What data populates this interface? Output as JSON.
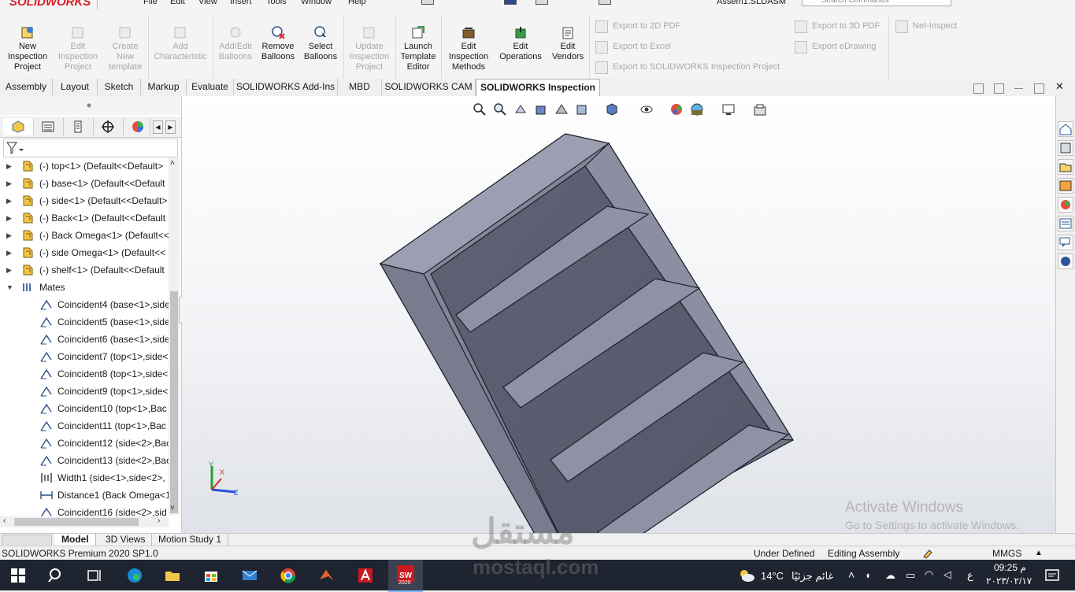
{
  "app": {
    "logo": "SOLIDWORKS",
    "filename": "Assem1.SLDASM",
    "search_placeholder": "Search Commands"
  },
  "menu": [
    "File",
    "Edit",
    "View",
    "Insert",
    "Tools",
    "Window",
    "Help"
  ],
  "ribbon": {
    "buttons": [
      {
        "label": "New\nInspection\nProject",
        "icon": "new-inspection-icon",
        "enabled": true
      },
      {
        "label": "Edit\nInspection\nProject",
        "icon": "edit-project-icon",
        "enabled": false
      },
      {
        "label": "Create\nNew\ntemplate",
        "icon": "create-template-icon",
        "enabled": false
      },
      {
        "label": "Add\nCharacteristic",
        "icon": "add-characteristic-icon",
        "enabled": false
      },
      {
        "label": "Add/Edit\nBalloons",
        "icon": "balloon-icon",
        "enabled": false
      },
      {
        "label": "Remove\nBalloons",
        "icon": "remove-balloon-icon",
        "enabled": true
      },
      {
        "label": "Select\nBalloons",
        "icon": "select-balloon-icon",
        "enabled": true
      },
      {
        "label": "Update\nInspection\nProject",
        "icon": "update-project-icon",
        "enabled": false
      },
      {
        "label": "Launch\nTemplate\nEditor",
        "icon": "template-editor-icon",
        "enabled": true
      },
      {
        "label": "Edit\nInspection\nMethods",
        "icon": "inspection-methods-icon",
        "enabled": true
      },
      {
        "label": "Edit\nOperations",
        "icon": "operations-icon",
        "enabled": true
      },
      {
        "label": "Edit\nVendors",
        "icon": "vendors-icon",
        "enabled": true
      }
    ],
    "exports": [
      "Export to 2D PDF",
      "Export to Excel",
      "Export to SOLIDWORKS Inspection Project",
      "Export to 3D PDF",
      "Export eDrawing",
      "Net-Inspect"
    ]
  },
  "tabs": [
    "Assembly",
    "Layout",
    "Sketch",
    "Markup",
    "Evaluate",
    "SOLIDWORKS Add-Ins",
    "MBD",
    "SOLIDWORKS CAM",
    "SOLIDWORKS Inspection"
  ],
  "active_tab": "SOLIDWORKS Inspection",
  "tree": {
    "components": [
      "(-) top<1> (Default<<Default>",
      "(-) base<1> (Default<<Default",
      "(-) side<1> (Default<<Default>",
      "(-) Back<1> (Default<<Default",
      "(-) Back Omega<1> (Default<<",
      "(-) side Omega<1> (Default<<",
      "(-) shelf<1> (Default<<Default"
    ],
    "mates_label": "Mates",
    "mates": [
      "Coincident4 (base<1>,side",
      "Coincident5 (base<1>,side",
      "Coincident6 (base<1>,side",
      "Coincident7 (top<1>,side<",
      "Coincident8 (top<1>,side<",
      "Coincident9 (top<1>,side<",
      "Coincident10 (top<1>,Bac",
      "Coincident11 (top<1>,Bac",
      "Coincident12 (side<2>,Bac",
      "Coincident13 (side<2>,Bac",
      "Width1 (side<1>,side<2>,",
      "Distance1 (Back Omega<1",
      "Coincident16 (side<2>,sid"
    ]
  },
  "triad": {
    "x": "X",
    "y": "Y",
    "z": "Z"
  },
  "watermark": {
    "line1": "Activate Windows",
    "line2": "Go to Settings to activate Windows."
  },
  "bottom_tabs": [
    "Model",
    "3D Views",
    "Motion Study 1"
  ],
  "status": {
    "product": "SOLIDWORKS Premium 2020 SP1.0",
    "state": "Under Defined",
    "mode": "Editing Assembly",
    "units": "MMGS"
  },
  "taskbar": {
    "temperature": "14°C",
    "weather": "غائم جزئيًا",
    "time": "09:25 م",
    "date": "٢٠٢٣/٠٢/١٧",
    "lang": "ع",
    "sw_badge": "2020"
  },
  "overlay": {
    "brand_ar": "مستقل",
    "brand_en": "mostaql.com"
  },
  "colors": {
    "accent": "#d51f26",
    "model_face": "#7b7d90",
    "model_edge": "#1e1f28"
  }
}
